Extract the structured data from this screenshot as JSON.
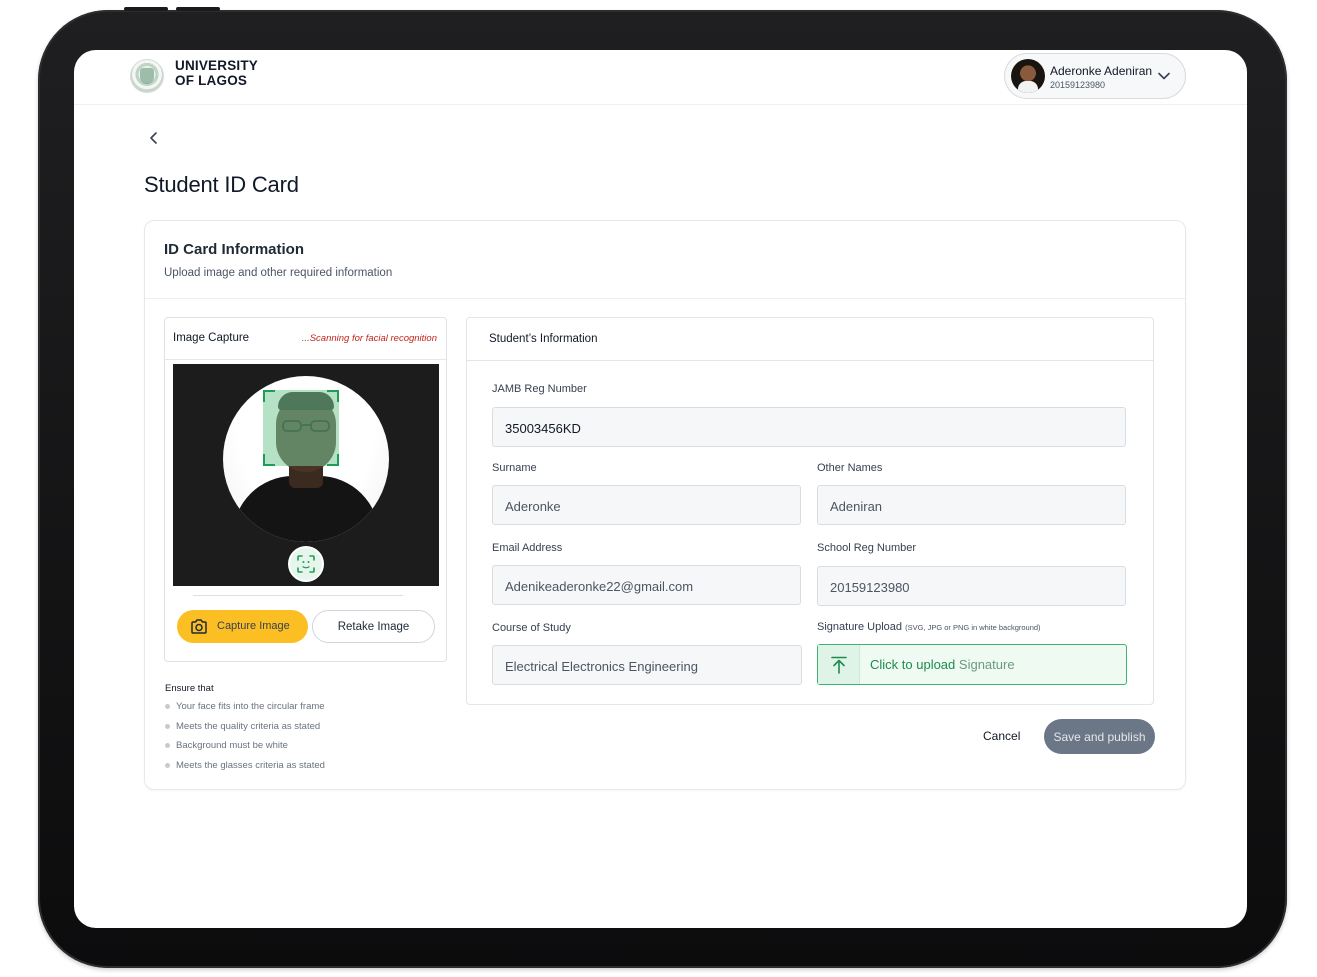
{
  "header": {
    "brand_line1": "UNIVERSITY",
    "brand_line2": "OF LAGOS",
    "user_name": "Aderonke Adeniran",
    "user_id": "20159123980"
  },
  "page": {
    "title": "Student ID Card"
  },
  "card": {
    "title": "ID Card Information",
    "subtitle": "Upload image and other required information"
  },
  "capture": {
    "title": "Image Capture",
    "status": "...Scanning for facial recognition",
    "capture_label": "Capture Image",
    "retake_label": "Retake Image",
    "ensure_title": "Ensure that",
    "ensure_items": [
      "Your face fits into the circular frame",
      "Meets the quality criteria as stated",
      "Background must be white",
      "Meets the glasses criteria as stated"
    ]
  },
  "student": {
    "title": "Student’s Information",
    "jamb_label": "JAMB Reg Number",
    "jamb_value": "35003456KD",
    "surname_label": "Surname",
    "surname_value": "Aderonke",
    "other_names_label": "Other Names",
    "other_names_value": "Adeniran",
    "email_label": "Email Address",
    "email_value": "Adenikeaderonke22@gmail.com",
    "school_reg_label": "School Reg Number",
    "school_reg_value": "20159123980",
    "course_label": "Course of Study",
    "course_value": "Electrical Electronics Engineering",
    "signature_label": "Signature Upload",
    "signature_hint": "(SVG, JPG or PNG in white background)",
    "upload_action": "Click to upload",
    "upload_target": "Signature"
  },
  "actions": {
    "cancel": "Cancel",
    "publish": "Save and publish"
  },
  "colors": {
    "accent_yellow": "#fbbf24",
    "success_green": "#1f8a4c",
    "scan_status_red": "#c0261d",
    "publish_button": "#6b7687"
  },
  "icons": [
    "back-arrow-icon",
    "chevron-down-icon",
    "face-scan-icon",
    "camera-icon",
    "upload-arrow-icon",
    "university-logo"
  ]
}
